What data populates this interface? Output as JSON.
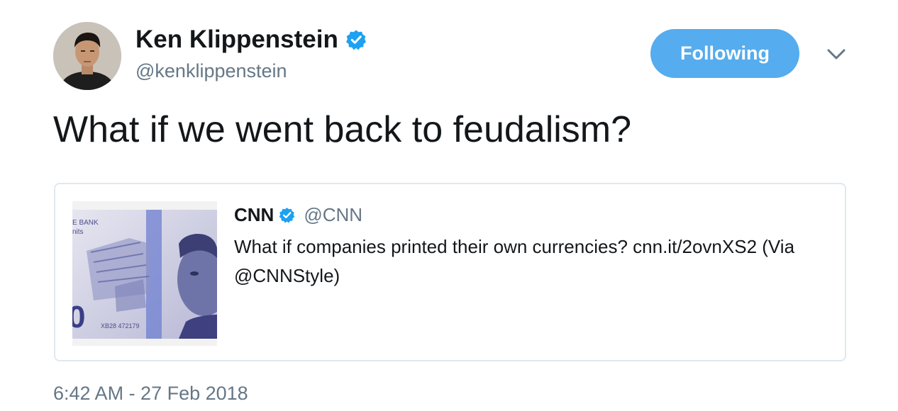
{
  "author": {
    "display_name": "Ken Klippenstein",
    "handle": "@kenklippenstein",
    "avatar_icon": "user-avatar",
    "verified_icon": "verified-badge-icon"
  },
  "follow_button": {
    "label": "Following",
    "color": "#55acee"
  },
  "menu_icon": "chevron-down-icon",
  "tweet": {
    "text": "What if we went back to feudalism?"
  },
  "quoted_tweet": {
    "display_name": "CNN",
    "handle": "@CNN",
    "text": "What if companies printed their own currencies? cnn.it/2ovnXS2 (Via @CNNStyle)",
    "media": {
      "bank_text": "E BANK",
      "sub_text": "nits",
      "serial": "XB28 472179",
      "denomination_fragment": "0"
    }
  },
  "timestamp": "6:42 AM - 27 Feb 2018",
  "colors": {
    "link_blue": "#1da1f2",
    "verified_blue": "#1da1f2",
    "text_dark": "#14171a",
    "text_grey": "#657786",
    "border": "#e1e8ed"
  }
}
